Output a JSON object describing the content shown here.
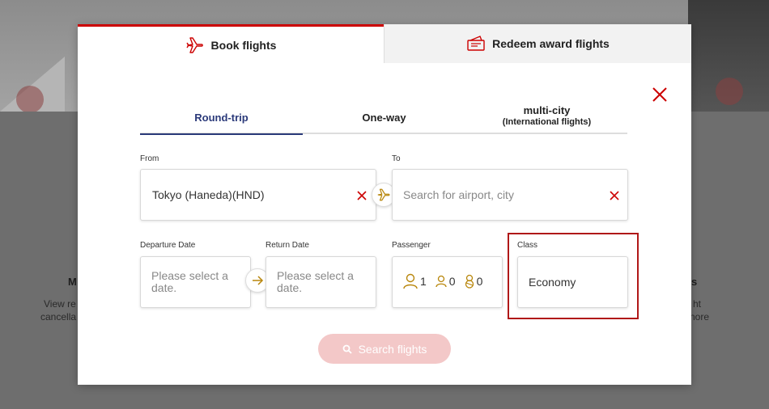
{
  "background": {
    "left_heading": "M",
    "left_line1": "View re",
    "left_line2": "cancella",
    "right_heading": "s",
    "right_line1": "ht",
    "right_line2": "nore"
  },
  "top_tabs": [
    {
      "label": "Book flights",
      "icon": "airplane-icon",
      "active": true
    },
    {
      "label": "Redeem award flights",
      "icon": "ticket-icon",
      "active": false
    }
  ],
  "trip_tabs": [
    {
      "label": "Round-trip",
      "sub": "",
      "active": true
    },
    {
      "label": "One-way",
      "sub": "",
      "active": false
    },
    {
      "label": "multi-city",
      "sub": "(International flights)",
      "active": false
    }
  ],
  "from": {
    "label": "From",
    "value": "Tokyo (Haneda)(HND)"
  },
  "to": {
    "label": "To",
    "placeholder": "Search for airport, city"
  },
  "departure": {
    "label": "Departure Date",
    "placeholder_line1": "Please select a",
    "placeholder_line2": "date."
  },
  "return": {
    "label": "Return Date",
    "placeholder_line1": "Please select a",
    "placeholder_line2": "date."
  },
  "passenger": {
    "label": "Passenger",
    "adults": "1",
    "children": "0",
    "infants": "0"
  },
  "class": {
    "label": "Class",
    "value": "Economy"
  },
  "search": {
    "label": "Search flights",
    "icon": "search-icon"
  },
  "colors": {
    "accent_red": "#cc0000",
    "active_tab_blue": "#2b3a7a",
    "gold_icon": "#b8860b",
    "search_disabled": "#f3c8c8"
  }
}
